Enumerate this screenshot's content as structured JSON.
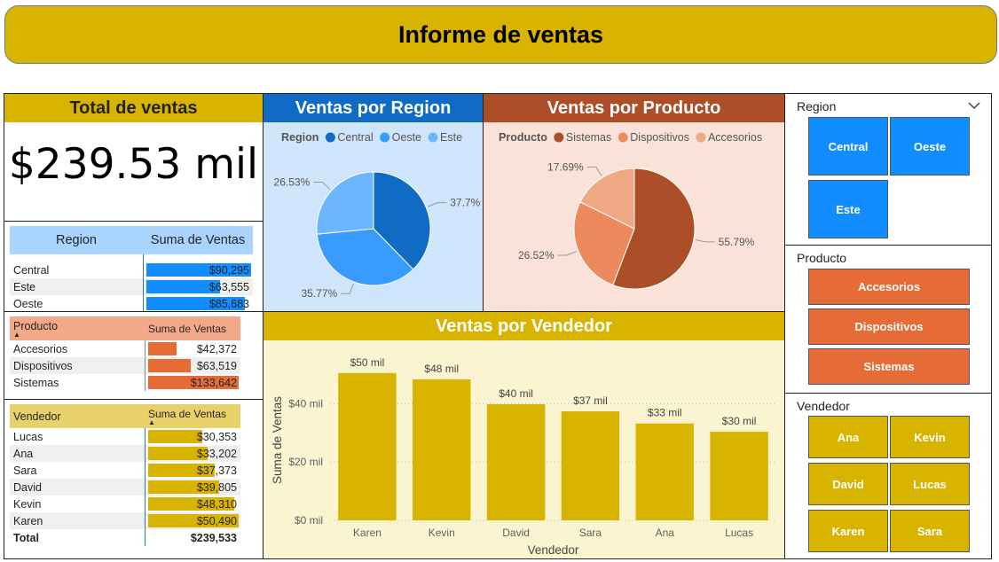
{
  "header": {
    "title": "Informe de ventas"
  },
  "kpi": {
    "title": "Total de ventas",
    "value": "$239.53 mil"
  },
  "region_table": {
    "headers": [
      "Region",
      "Suma de Ventas"
    ],
    "rows": [
      {
        "label": "Central",
        "value": "$90,295",
        "amount": 90295
      },
      {
        "label": "Este",
        "value": "$63,555",
        "amount": 63555
      },
      {
        "label": "Oeste",
        "value": "$85,683",
        "amount": 85683
      }
    ],
    "bar_color": "#118DFF"
  },
  "producto_table": {
    "headers": [
      "Producto",
      "Suma de Ventas"
    ],
    "sort_icon": "sort-up-icon",
    "rows": [
      {
        "label": "Accesorios",
        "value": "$42,372",
        "amount": 42372
      },
      {
        "label": "Dispositivos",
        "value": "$63,519",
        "amount": 63519
      },
      {
        "label": "Sistemas",
        "value": "$133,642",
        "amount": 133642
      }
    ],
    "bar_color": "#E66C37"
  },
  "vendedor_table": {
    "headers": [
      "Vendedor",
      "Suma de Ventas"
    ],
    "sort_icon": "sort-up-icon",
    "rows": [
      {
        "label": "Lucas",
        "value": "$30,353",
        "amount": 30353
      },
      {
        "label": "Ana",
        "value": "$33,202",
        "amount": 33202
      },
      {
        "label": "Sara",
        "value": "$37,373",
        "amount": 37373
      },
      {
        "label": "David",
        "value": "$39,805",
        "amount": 39805
      },
      {
        "label": "Kevin",
        "value": "$48,310",
        "amount": 48310
      },
      {
        "label": "Karen",
        "value": "$50,490",
        "amount": 50490
      }
    ],
    "total_label": "Total",
    "total_value": "$239,533",
    "bar_color": "#D8B400"
  },
  "slicers": {
    "region": {
      "title": "Region",
      "items": [
        "Central",
        "Oeste",
        "Este"
      ],
      "color": "#118DFF",
      "icon": "chevron-down-icon"
    },
    "producto": {
      "title": "Producto",
      "items": [
        "Accesorios",
        "Dispositivos",
        "Sistemas"
      ],
      "color": "#E66C37"
    },
    "vendedor": {
      "title": "Vendedor",
      "items": [
        "Ana",
        "Kevin",
        "David",
        "Lucas",
        "Karen",
        "Sara"
      ],
      "color": "#D8B400"
    }
  },
  "chart_data": [
    {
      "type": "pie",
      "title": "Ventas por Region",
      "legend_title": "Region",
      "legend_position": "top",
      "categories": [
        "Central",
        "Oeste",
        "Este"
      ],
      "values": [
        37.7,
        35.77,
        26.53
      ],
      "labels": [
        "37.7%",
        "35.77%",
        "26.53%"
      ],
      "colors": [
        "#0F6BC4",
        "#3A9BFF",
        "#6DB6FF"
      ],
      "title_bg": "#0F6BC4",
      "panel_bg": "#CFE5FC"
    },
    {
      "type": "pie",
      "title": "Ventas por Producto",
      "legend_title": "Producto",
      "legend_position": "top",
      "categories": [
        "Sistemas",
        "Dispositivos",
        "Accesorios"
      ],
      "values": [
        55.79,
        26.52,
        17.69
      ],
      "labels": [
        "55.79%",
        "26.52%",
        "17.69%"
      ],
      "colors": [
        "#AC4E27",
        "#EC8A5E",
        "#F0A884"
      ],
      "title_bg": "#AC4E27",
      "panel_bg": "#FAE2D8"
    },
    {
      "type": "bar",
      "title": "Ventas por Vendedor",
      "categories": [
        "Karen",
        "Kevin",
        "David",
        "Sara",
        "Ana",
        "Lucas"
      ],
      "values": [
        50490,
        48310,
        39805,
        37373,
        33202,
        30353
      ],
      "data_labels": [
        "$50 mil",
        "$48 mil",
        "$40 mil",
        "$37 mil",
        "$33 mil",
        "$30 mil"
      ],
      "xlabel": "Vendedor",
      "ylabel": "Suma de Ventas",
      "ylim": [
        0,
        55000
      ],
      "yticks": [
        0,
        20000,
        40000
      ],
      "ytick_labels": [
        "$0 mil",
        "$20 mil",
        "$40 mil"
      ],
      "grid": true,
      "bar_color": "#D8B400",
      "title_bg": "#D8B400",
      "panel_bg": "#FBF4D1"
    }
  ]
}
